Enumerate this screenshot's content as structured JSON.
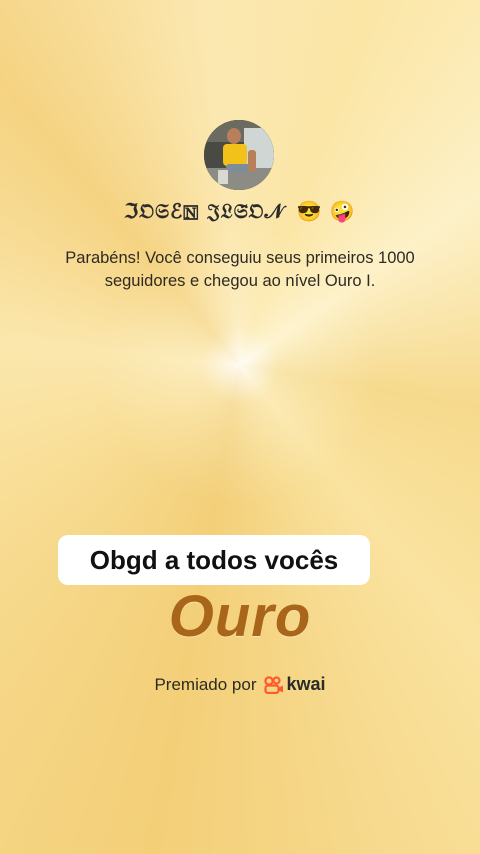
{
  "profile": {
    "username": "ℑ𝔒𝔖ℰ🄽 𝔍𝔏𝔖̈𝔒𝒩",
    "emojis": "😎 🤪"
  },
  "message": "Parabéns! Você conseguiu seus primeiros 1000 seguidores e chegou ao nível Ouro I.",
  "caption": "Obgd a todos vocês",
  "level": {
    "name": "Ouro"
  },
  "award": {
    "prefix": "Premiado por",
    "brand": "kwai",
    "brand_color": "#ff5a2c"
  }
}
